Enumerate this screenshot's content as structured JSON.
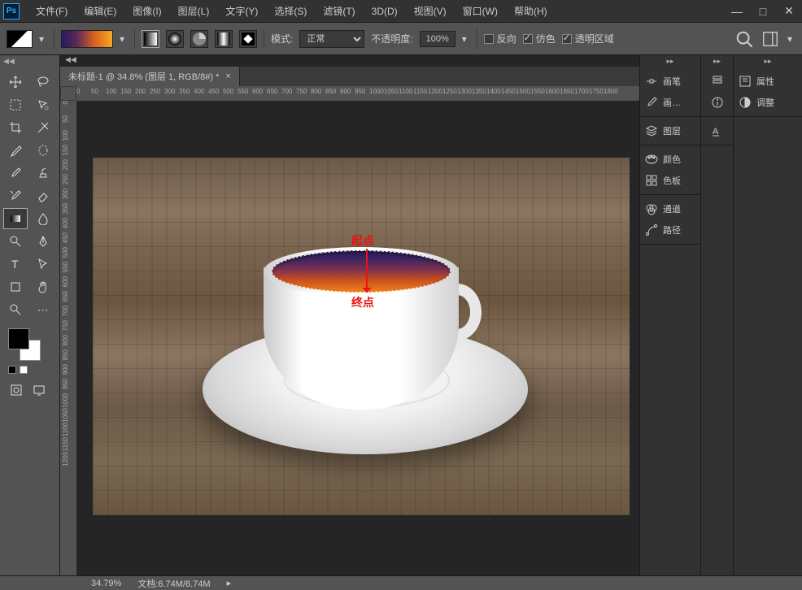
{
  "menu": {
    "items": [
      "文件(F)",
      "编辑(E)",
      "图像(I)",
      "图层(L)",
      "文字(Y)",
      "选择(S)",
      "滤镜(T)",
      "3D(D)",
      "视图(V)",
      "窗口(W)",
      "帮助(H)"
    ]
  },
  "options": {
    "mode_label": "模式:",
    "mode_value": "正常",
    "opacity_label": "不透明度:",
    "opacity_value": "100%",
    "reverse": "反向",
    "dither": "仿色",
    "transparency": "透明区域",
    "reverse_checked": false,
    "dither_checked": true,
    "transparency_checked": true
  },
  "document": {
    "tab_title": "未标题-1 @ 34.8% (图层 1, RGB/8#) *",
    "ruler_h": [
      "0",
      "50",
      "100",
      "150",
      "200",
      "250",
      "300",
      "350",
      "400",
      "450",
      "500",
      "550",
      "600",
      "650",
      "700",
      "750",
      "800",
      "850",
      "900",
      "950",
      "1000",
      "1050",
      "1100",
      "1150",
      "1200",
      "1250",
      "1300",
      "1350",
      "1400",
      "1450",
      "1500",
      "1550",
      "1600",
      "1650",
      "1700",
      "1750",
      "1800"
    ],
    "ruler_v": [
      "0",
      "50",
      "100",
      "150",
      "200",
      "250",
      "300",
      "350",
      "400",
      "450",
      "500",
      "550",
      "600",
      "650",
      "700",
      "750",
      "800",
      "850",
      "900",
      "950",
      "1000",
      "1050",
      "1100",
      "1150",
      "1200"
    ],
    "annot_start": "起点",
    "annot_end": "终点"
  },
  "panels": {
    "brush": "画笔",
    "brush_presets": "画…",
    "layers": "图层",
    "colors": "颜色",
    "swatches": "色板",
    "channels": "通道",
    "paths": "路径",
    "properties": "属性",
    "adjustments": "调整"
  },
  "status": {
    "zoom": "34.79%",
    "doc_info": "文档:6.74M/6.74M"
  },
  "colors_ui": {
    "foreground": "#000000",
    "background": "#ffffff"
  }
}
